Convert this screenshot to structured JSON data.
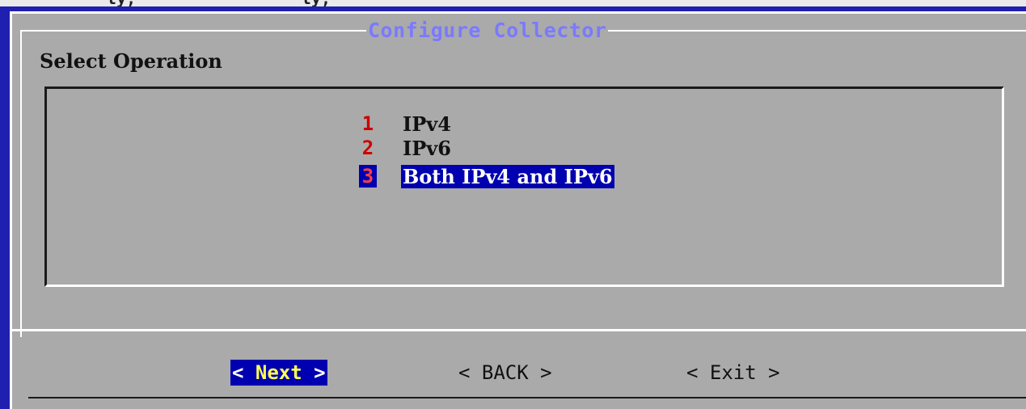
{
  "top_strip_text": "_ty, ___ _____ _____ ty,",
  "dialog": {
    "title": "Configure Collector",
    "prompt": "Select Operation"
  },
  "menu": {
    "items": [
      {
        "tag": "1",
        "label": "IPv4",
        "selected": false
      },
      {
        "tag": "2",
        "label": "IPv6",
        "selected": false
      },
      {
        "tag": "3",
        "label": "Both IPv4 and IPv6",
        "selected": true
      }
    ]
  },
  "buttons": {
    "next": {
      "left": "< ",
      "word": "Next",
      "right": " >",
      "selected": true
    },
    "back": {
      "left": "< ",
      "word": "BACK",
      "right": " >",
      "selected": false
    },
    "exit": {
      "left": "< ",
      "word": "Exit",
      "right": " >",
      "selected": false
    }
  },
  "colors": {
    "background": "#1f1fb0",
    "dialog": "#aaaaaa",
    "title": "#7a7aff",
    "selection": "#0000b0",
    "tag": "#cc0000",
    "button_highlight": "#ffff55"
  }
}
